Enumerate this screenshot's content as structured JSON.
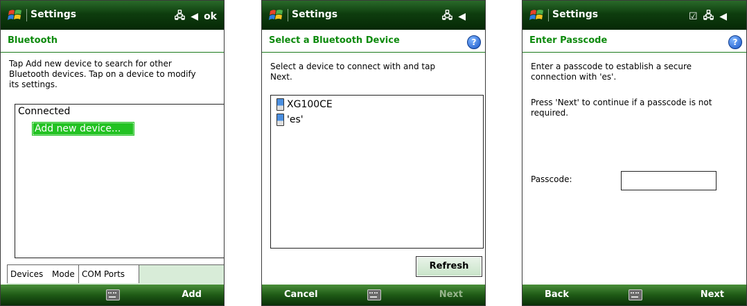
{
  "screens": [
    {
      "app_title": "Settings",
      "status_icons": [
        "connectivity-icon",
        "speaker-icon"
      ],
      "ok_label": "ok",
      "header": "Bluetooth",
      "instructions": [
        "Tap Add new device to search for other",
        "Bluetooth devices. Tap on a device to modify",
        "its settings."
      ],
      "list_group": "Connected",
      "list_item": "Add new device...",
      "tabs": [
        "Devices",
        "Mode",
        "COM Ports"
      ],
      "softkey_right": "Add"
    },
    {
      "app_title": "Settings",
      "header": "Select a Bluetooth Device",
      "help": "?",
      "instructions": [
        "Select a device to connect with and tap",
        "Next."
      ],
      "devices": [
        "XG100CE",
        "'es'"
      ],
      "refresh_label": "Refresh",
      "softkey_left": "Cancel",
      "softkey_right": "Next"
    },
    {
      "app_title": "Settings",
      "header": "Enter Passcode",
      "help": "?",
      "instructions": [
        "Enter a passcode to establish a secure",
        "connection with 'es'."
      ],
      "note": [
        "Press 'Next' to continue if a passcode is not",
        "required."
      ],
      "passcode_label": "Passcode:",
      "passcode_value": "",
      "softkey_left": "Back",
      "softkey_right": "Next"
    }
  ],
  "colors": {
    "title_green": "#0e3d0e",
    "header_green": "#0d8a0d",
    "highlight": "#22c222"
  }
}
